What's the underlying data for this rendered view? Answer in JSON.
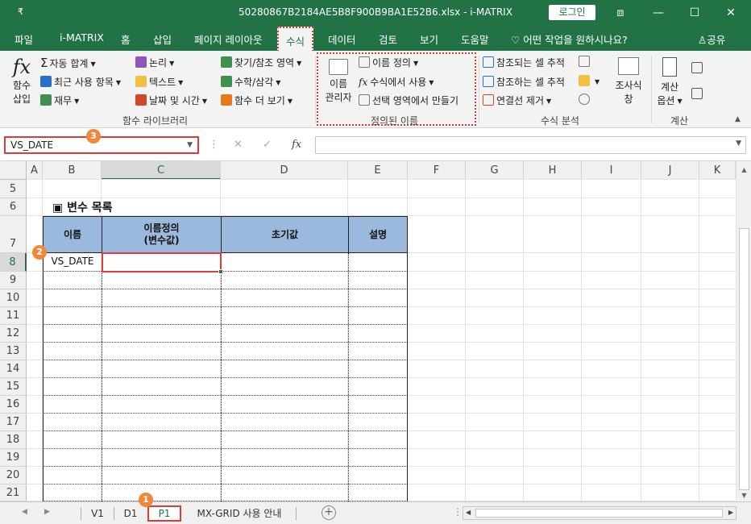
{
  "titlebar": {
    "quick_access": "₹",
    "title": "50280867B2184AE5B8F900B9BA1E52B6.xlsx  -  i-MATRIX",
    "login": "로그인",
    "btn_ribbon": "⧈",
    "btn_min": "—",
    "btn_max": "☐",
    "btn_close": "✕",
    "color": "#217346"
  },
  "tabs": [
    "파일",
    "i-MATRIX",
    "홈",
    "삽입",
    "페이지 레이아웃",
    "수식",
    "데이터",
    "검토",
    "보기",
    "도움말"
  ],
  "active_tab": "수식",
  "tell_me": "어떤 작업을 원하시나요?",
  "share": "공유",
  "ribbon": {
    "insert_function": {
      "icon": "fx",
      "label1": "함수",
      "label2": "삽입"
    },
    "function_library": {
      "autosum": "자동 합계",
      "recent": "최근 사용 항목",
      "financial": "재무",
      "logical": "논리",
      "text": "텍스트",
      "datetime": "날짜 및 시간",
      "lookup": "찾기/참조 영역",
      "math": "수학/삼각",
      "more": "함수 더 보기",
      "group_label": "함수 라이브러리"
    },
    "defined_names": {
      "name_manager1": "이름",
      "name_manager2": "관리자",
      "define_name": "이름 정의",
      "use_in_formula": "수식에서 사용",
      "create_from_selection": "선택 영역에서 만들기",
      "group_label": "정의된 이름"
    },
    "formula_auditing": {
      "trace_precedents": "참조되는 셀 추적",
      "trace_dependents": "참조하는 셀 추적",
      "remove_arrows": "연결선 제거",
      "watch1": "조사식",
      "watch2": "창",
      "group_label": "수식 분석"
    },
    "calculation": {
      "options1": "계산",
      "options2": "옵션",
      "group_label": "계산"
    }
  },
  "formula_bar": {
    "name_box": "VS_DATE",
    "cancel": "✕",
    "enter": "✓",
    "fx": "fx",
    "formula": ""
  },
  "grid": {
    "columns": [
      "A",
      "B",
      "C",
      "D",
      "E",
      "F",
      "G",
      "H",
      "I",
      "J",
      "K"
    ],
    "selected_column": "C",
    "rows": [
      "5",
      "6",
      "7",
      "8",
      "9",
      "10",
      "11",
      "12",
      "13",
      "14",
      "15",
      "16",
      "17",
      "18",
      "19",
      "20",
      "21"
    ],
    "selected_row": "8",
    "section_title": "▣ 변수 목록",
    "headers": {
      "name": "이름",
      "name_def1": "이름정의",
      "name_def2": "(변수값)",
      "initial": "초기값",
      "desc": "설명"
    },
    "row8_name": "VS_DATE",
    "header_color": "#9bb8dd"
  },
  "badges": {
    "one": "1",
    "two": "2",
    "three": "3"
  },
  "sheets": [
    "V1",
    "D1",
    "P1",
    "MX-GRID 사용 안내"
  ],
  "active_sheet": "P1",
  "add_sheet": "+"
}
